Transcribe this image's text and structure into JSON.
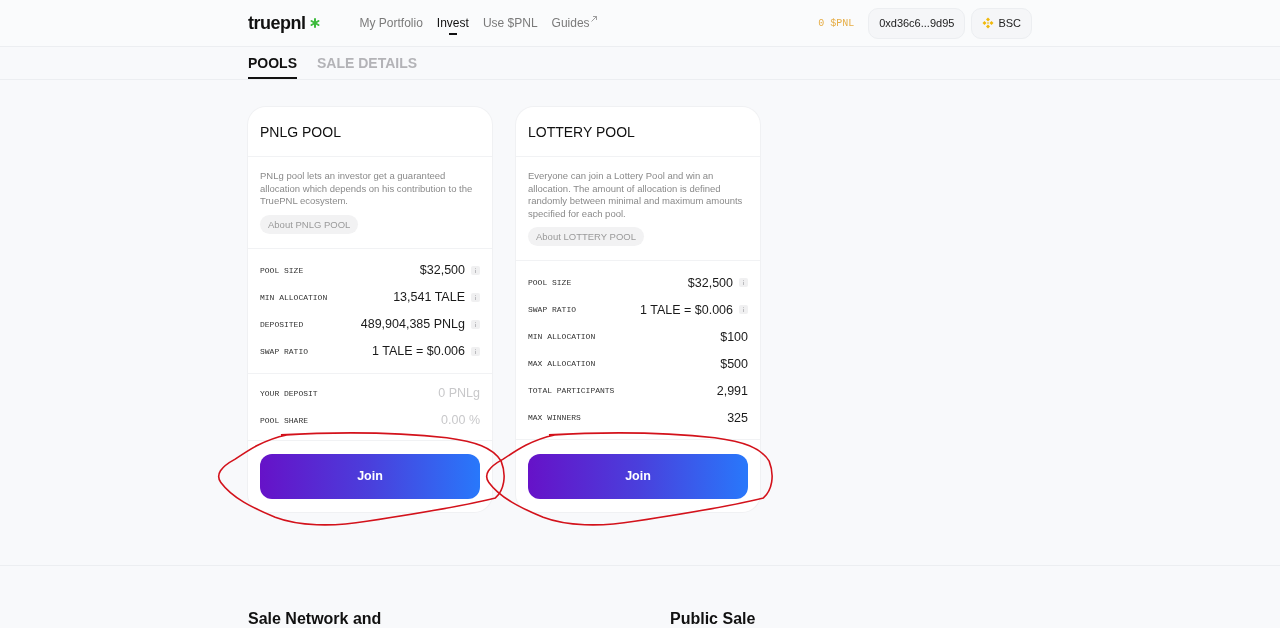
{
  "header": {
    "logo": "truepnl",
    "nav": [
      {
        "label": "My Portfolio",
        "selected": false,
        "external": false
      },
      {
        "label": "Invest",
        "selected": true,
        "external": false
      },
      {
        "label": "Use $PNL",
        "selected": false,
        "external": false
      },
      {
        "label": "Guides",
        "selected": false,
        "external": true
      }
    ],
    "balance": "0 $PNL",
    "wallet": "0xd36c6...9d95",
    "network": "BSC"
  },
  "tabs": [
    {
      "label": "POOLS",
      "selected": true
    },
    {
      "label": "SALE DETAILS",
      "selected": false
    }
  ],
  "pools": [
    {
      "title": "PNLG POOL",
      "description": "PNLg pool lets an investor get a guaranteed allocation which depends on his contribution to the TruePNL ecosystem.",
      "about": "About PNLG POOL",
      "stats": [
        {
          "label": "POOL SIZE",
          "value": "$32,500",
          "info": true
        },
        {
          "label": "MIN ALLOCATION",
          "value": "13,541 TALE",
          "info": true
        },
        {
          "label": "DEPOSITED",
          "value": "489,904,385 PNLg",
          "info": true
        },
        {
          "label": "SWAP RATIO",
          "value": "1 TALE = $0.006",
          "info": true
        }
      ],
      "user_stats": [
        {
          "label": "YOUR DEPOSIT",
          "value": "0 PNLg"
        },
        {
          "label": "POOL SHARE",
          "value": "0.00 %"
        }
      ],
      "button": "Join",
      "highlighted": true
    },
    {
      "title": "LOTTERY POOL",
      "description": "Everyone can join a Lottery Pool and win an allocation. The amount of allocation is defined randomly between minimal and maximum amounts specified for each pool.",
      "about": "About LOTTERY POOL",
      "stats": [
        {
          "label": "POOL SIZE",
          "value": "$32,500",
          "info": true
        },
        {
          "label": "SWAP RATIO",
          "value": "1 TALE = $0.006",
          "info": true
        },
        {
          "label": "MIN ALLOCATION",
          "value": "$100",
          "info": false
        },
        {
          "label": "MAX ALLOCATION",
          "value": "$500",
          "info": false
        },
        {
          "label": "TOTAL PARTICIPANTS",
          "value": "2,991",
          "info": false
        },
        {
          "label": "MAX WINNERS",
          "value": "325",
          "info": false
        }
      ],
      "button": "Join",
      "highlighted": true
    }
  ],
  "sections": [
    {
      "title": "Sale Network and"
    },
    {
      "title": "Public Sale"
    }
  ]
}
